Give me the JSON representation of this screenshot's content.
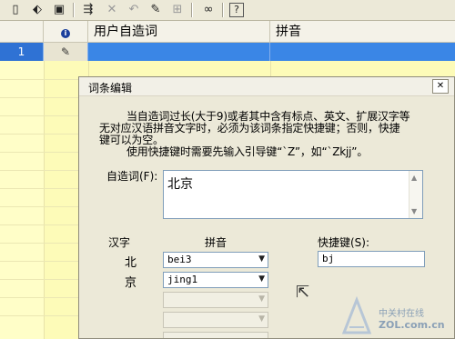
{
  "toolbar": {
    "icons": [
      "new-icon",
      "bookmark-icon",
      "save-icon",
      "split-icon",
      "close-icon",
      "undo-icon",
      "auto-icon",
      "add-row-icon",
      "binoculars-icon",
      "help-icon"
    ]
  },
  "grid": {
    "headers": [
      "用户自造词",
      "拼音"
    ],
    "info_icon": "i",
    "selected_row": {
      "num": "1"
    }
  },
  "dialog": {
    "title": "词条编辑",
    "desc_line1": "当自造词过长(大于9)或者其中含有标点、英文、扩展汉字等",
    "desc_line2": "无对应汉语拼音文字时，必须为该词条指定快捷键；否则，快捷",
    "desc_line3": "键可以为空。",
    "desc_line4": "使用快捷键时需要先输入引导键“`Z”，如“`Zkjj”。",
    "word_label": "自造词(F):",
    "word_value": "北京",
    "col_hanzi": "汉字",
    "col_pinyin": "拼音",
    "shortcut_label": "快捷键(S):",
    "chars": [
      {
        "hanzi": "北",
        "pinyin": "bei3"
      },
      {
        "hanzi": "京",
        "pinyin": "jing1"
      }
    ],
    "shortcut_value": "bj"
  },
  "watermark": {
    "line1": "中关村在线",
    "line2": "ZOL.com.cn"
  }
}
